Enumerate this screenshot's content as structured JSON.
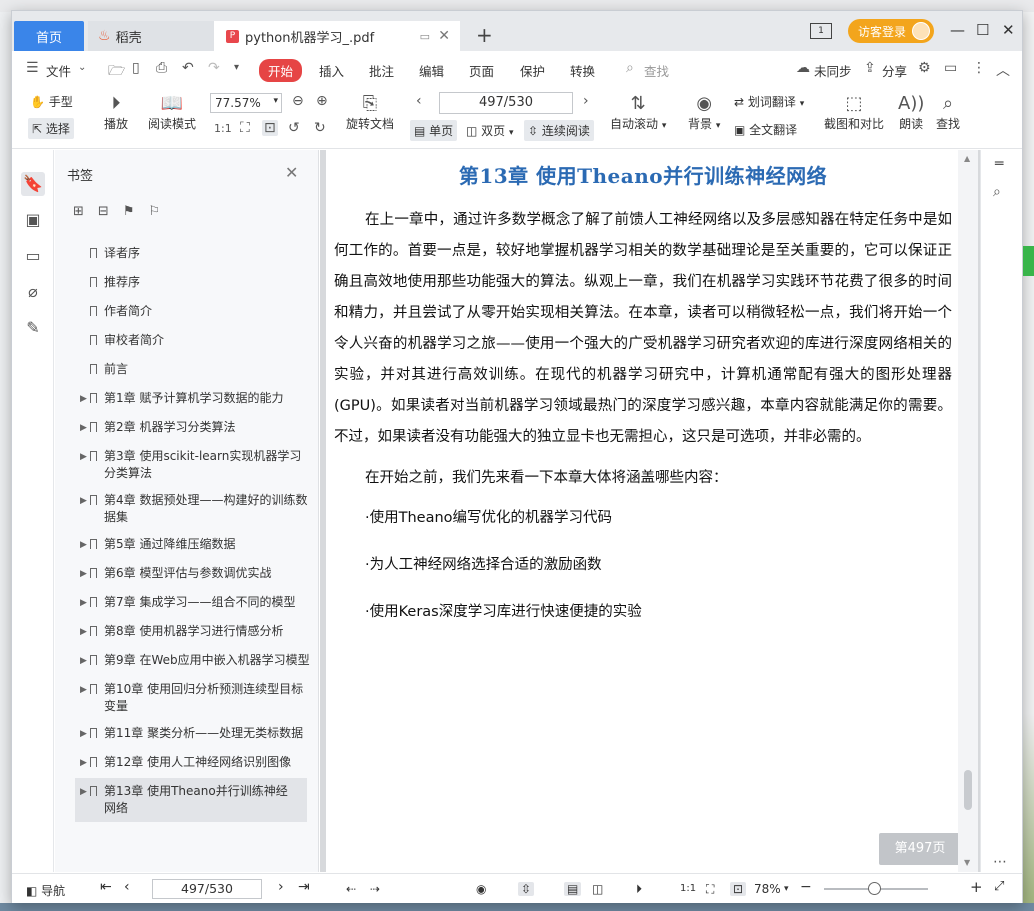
{
  "tabs": {
    "home": "首页",
    "docer": "稻壳",
    "pdf": "python机器学习_.pdf",
    "new_tab": "+"
  },
  "titlebar": {
    "login": "访客登录",
    "page_count_icon": "1"
  },
  "menu": {
    "file": "文件",
    "start": "开始",
    "insert": "插入",
    "annotate": "批注",
    "edit": "编辑",
    "page": "页面",
    "protect": "保护",
    "convert": "转换",
    "search_placeholder": "查找",
    "sync": "未同步",
    "share": "分享"
  },
  "ribbon": {
    "hand": "手型",
    "select": "选择",
    "play": "播放",
    "read_mode": "阅读模式",
    "zoom": "77.57%",
    "rotate_doc": "旋转文档",
    "page_input": "497/530",
    "single_page": "单页",
    "double_page": "双页",
    "continuous": "连续阅读",
    "auto_scroll": "自动滚动",
    "background": "背景",
    "word_translate": "划词翻译",
    "full_translate": "全文翻译",
    "screenshot_compare": "截图和对比",
    "read_aloud": "朗读",
    "find": "查找"
  },
  "bookmarks": {
    "title": "书签",
    "items": [
      {
        "label": "译者序",
        "expandable": false
      },
      {
        "label": "推荐序",
        "expandable": false
      },
      {
        "label": "作者简介",
        "expandable": false
      },
      {
        "label": "审校者简介",
        "expandable": false
      },
      {
        "label": "前言",
        "expandable": false
      },
      {
        "label": "第1章 赋予计算机学习数据的能力",
        "expandable": true
      },
      {
        "label": "第2章 机器学习分类算法",
        "expandable": true
      },
      {
        "label": "第3章 使用scikit-learn实现机器学习分类算法",
        "expandable": true
      },
      {
        "label": "第4章 数据预处理——构建好的训练数据集",
        "expandable": true
      },
      {
        "label": "第5章 通过降维压缩数据",
        "expandable": true
      },
      {
        "label": "第6章 模型评估与参数调优实战",
        "expandable": true
      },
      {
        "label": "第7章 集成学习——组合不同的模型",
        "expandable": true
      },
      {
        "label": "第8章 使用机器学习进行情感分析",
        "expandable": true
      },
      {
        "label": "第9章 在Web应用中嵌入机器学习模型",
        "expandable": true
      },
      {
        "label": "第10章 使用回归分析预测连续型目标变量",
        "expandable": true
      },
      {
        "label": "第11章 聚类分析——处理无类标数据",
        "expandable": true
      },
      {
        "label": "第12章 使用人工神经网络识别图像",
        "expandable": true
      },
      {
        "label": "第13章 使用Theano并行训练神经网络",
        "expandable": true,
        "selected": true
      }
    ]
  },
  "document": {
    "chapter_title": "第13章   使用Theano并行训练神经网络",
    "paragraph1": "在上一章中，通过许多数学概念了解了前馈人工神经网络以及多层感知器在特定任务中是如何工作的。首要一点是，较好地掌握机器学习相关的数学基础理论是至关重要的，它可以保证正确且高效地使用那些功能强大的算法。纵观上一章，我们在机器学习实践环节花费了很多的时间和精力，并且尝试了从零开始实现相关算法。在本章，读者可以稍微轻松一点，我们将开始一个令人兴奋的机器学习之旅——使用一个强大的广受机器学习研究者欢迎的库进行深度网络相关的实验，并对其进行高效训练。在现代的机器学习研究中，计算机通常配有强大的图形处理器(GPU)。如果读者对当前机器学习领域最热门的深度学习感兴趣，本章内容就能满足你的需要。不过，如果读者没有功能强大的独立显卡也无需担心，这只是可选项，并非必需的。",
    "paragraph2": "在开始之前，我们先来看一下本章大体将涵盖哪些内容：",
    "bullets": [
      "·使用Theano编写优化的机器学习代码",
      "·为人工神经网络选择合适的激励函数",
      "·使用Keras深度学习库进行快速便捷的实验"
    ],
    "page_badge": "第497页"
  },
  "statusbar": {
    "nav": "导航",
    "page_input": "497/530",
    "zoom": "78%"
  },
  "colors": {
    "accent_blue": "#3a85e9",
    "start_red": "#e64545",
    "login_orange": "#f3a51c",
    "chapter_blue": "#2b6ab3"
  }
}
